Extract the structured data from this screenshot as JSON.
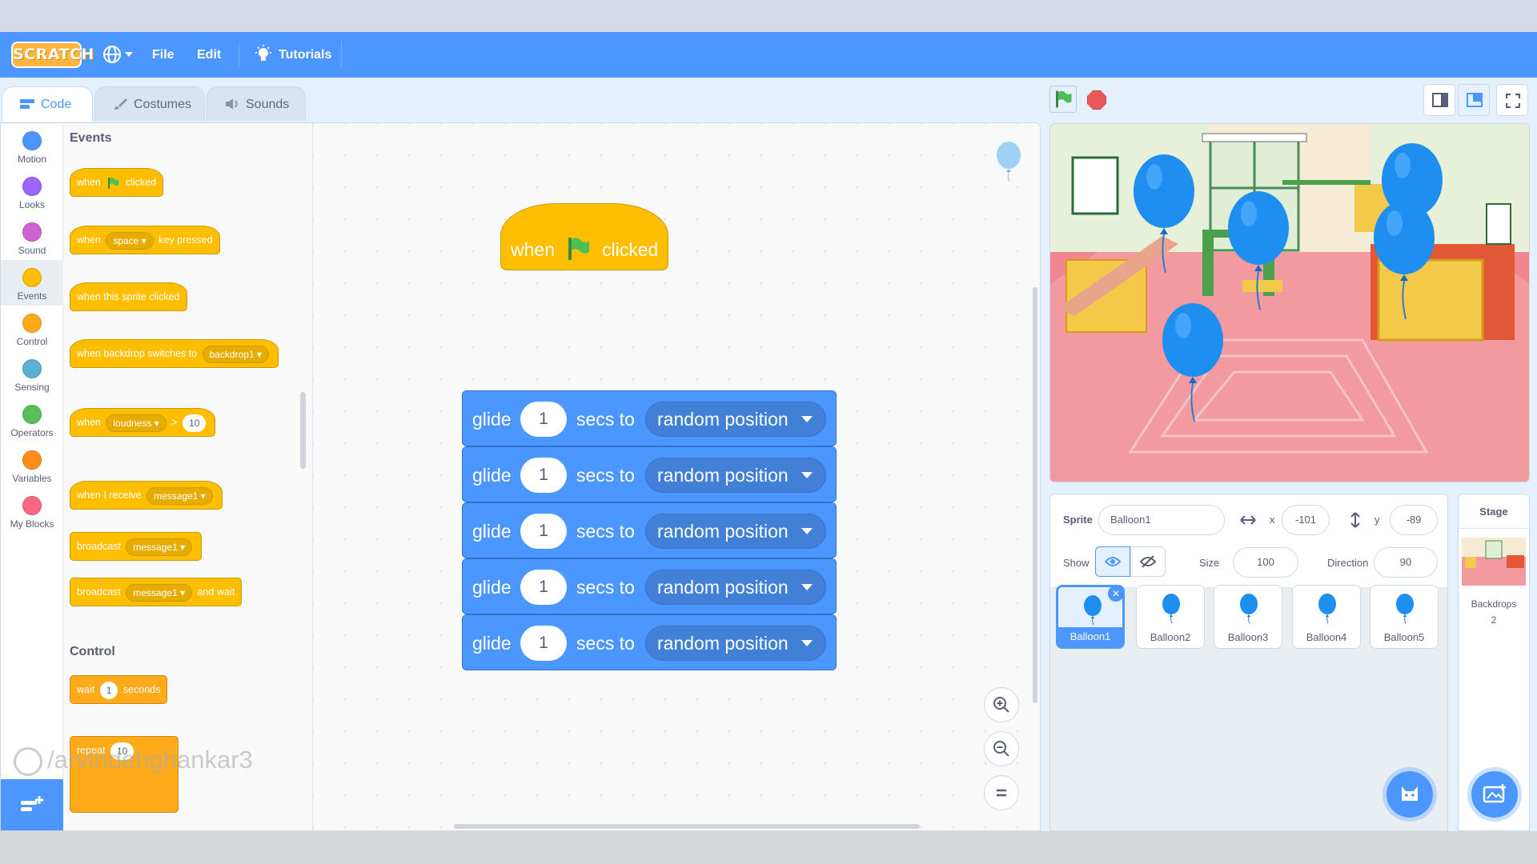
{
  "menubar": {
    "logo": "SCRATCH",
    "file": "File",
    "edit": "Edit",
    "tutorials": "Tutorials"
  },
  "tabs": [
    {
      "label": "Code"
    },
    {
      "label": "Costumes"
    },
    {
      "label": "Sounds"
    }
  ],
  "categories": [
    {
      "label": "Motion",
      "color": "#4c97ff"
    },
    {
      "label": "Looks",
      "color": "#9966ff"
    },
    {
      "label": "Sound",
      "color": "#cf63cf"
    },
    {
      "label": "Events",
      "color": "#ffbf00"
    },
    {
      "label": "Control",
      "color": "#ffab19"
    },
    {
      "label": "Sensing",
      "color": "#5cb1d6"
    },
    {
      "label": "Operators",
      "color": "#59c059"
    },
    {
      "label": "Variables",
      "color": "#ff8c1a"
    },
    {
      "label": "My Blocks",
      "color": "#ff6680"
    }
  ],
  "palette": {
    "events_heading": "Events",
    "control_heading": "Control",
    "when": "when",
    "clicked": "clicked",
    "space": "space",
    "key_pressed": "key pressed",
    "when_sprite_clicked": "when this sprite clicked",
    "when_backdrop": "when backdrop switches to",
    "backdrop1": "backdrop1",
    "loudness": "loudness",
    "gt": ">",
    "loud_val": "10",
    "when_receive": "when I receive",
    "message1": "message1",
    "broadcast": "broadcast",
    "and_wait": "and wait",
    "wait": "wait",
    "wait_val": "1",
    "seconds": "seconds",
    "repeat": "repeat",
    "repeat_val": "10"
  },
  "script": {
    "hat": {
      "when": "when",
      "clicked": "clicked"
    },
    "glide_blocks": [
      {
        "glide": "glide",
        "secs": "1",
        "to": "secs to",
        "target": "random position"
      },
      {
        "glide": "glide",
        "secs": "1",
        "to": "secs to",
        "target": "random position"
      },
      {
        "glide": "glide",
        "secs": "1",
        "to": "secs to",
        "target": "random position"
      },
      {
        "glide": "glide",
        "secs": "1",
        "to": "secs to",
        "target": "random position"
      },
      {
        "glide": "glide",
        "secs": "1",
        "to": "secs to",
        "target": "random position"
      }
    ]
  },
  "watermark": "/arvindehghankar3",
  "sprite_info": {
    "sprite_label": "Sprite",
    "sprite_name": "Balloon1",
    "x_label": "x",
    "x": "-101",
    "y_label": "y",
    "y": "-89",
    "show_label": "Show",
    "size_label": "Size",
    "size": "100",
    "direction_label": "Direction",
    "direction": "90"
  },
  "sprites": [
    {
      "name": "Balloon1"
    },
    {
      "name": "Balloon2"
    },
    {
      "name": "Balloon3"
    },
    {
      "name": "Balloon4"
    },
    {
      "name": "Balloon5"
    }
  ],
  "stage_panel": {
    "title": "Stage",
    "backdrops_label": "Backdrops",
    "backdrops_count": "2"
  },
  "colors": {
    "scratch_blue": "#4c97ff",
    "events_yellow": "#ffbf00",
    "motion_blue": "#4c97ff"
  }
}
